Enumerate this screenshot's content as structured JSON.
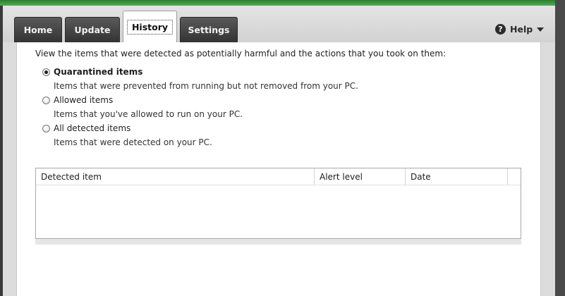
{
  "tabs": [
    {
      "label": "Home"
    },
    {
      "label": "Update"
    },
    {
      "label": "History"
    },
    {
      "label": "Settings"
    }
  ],
  "active_tab": "History",
  "help": {
    "label": "Help",
    "icon": "question-circle-icon"
  },
  "intro_text": "View the items that were detected as potentially harmful and the actions that you took on them:",
  "options": [
    {
      "label": "Quarantined items",
      "description": "Items that were prevented from running but not removed from your PC.",
      "selected": true
    },
    {
      "label": "Allowed items",
      "description": "Items that you've allowed to run on your PC.",
      "selected": false
    },
    {
      "label": "All detected items",
      "description": "Items that were detected on your PC.",
      "selected": false
    }
  ],
  "table": {
    "columns": [
      "Detected item",
      "Alert level",
      "Date"
    ],
    "rows": []
  },
  "colors": {
    "accent_green": "#4caf50",
    "tab_dark": "#3a3a3a",
    "panel_bg": "#ffffff"
  }
}
